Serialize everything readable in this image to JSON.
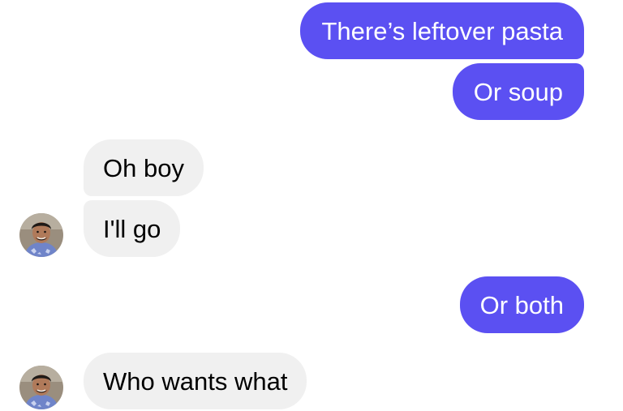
{
  "messages": [
    {
      "id": "m1",
      "direction": "outgoing",
      "text": "There’s leftover pasta"
    },
    {
      "id": "m2",
      "direction": "outgoing",
      "text": "Or soup"
    },
    {
      "id": "m3",
      "direction": "incoming",
      "text": "Oh boy"
    },
    {
      "id": "m4",
      "direction": "incoming",
      "text": "I'll go"
    },
    {
      "id": "m5",
      "direction": "outgoing",
      "text": "Or both"
    },
    {
      "id": "m6",
      "direction": "incoming",
      "text": "Who wants what"
    }
  ],
  "colors": {
    "outgoing_bubble": "#5b50f2",
    "incoming_bubble": "#f0f0f0",
    "outgoing_text": "#ffffff",
    "incoming_text": "#000000"
  },
  "icons": {
    "contact_avatar": "avatar-photo-icon"
  }
}
